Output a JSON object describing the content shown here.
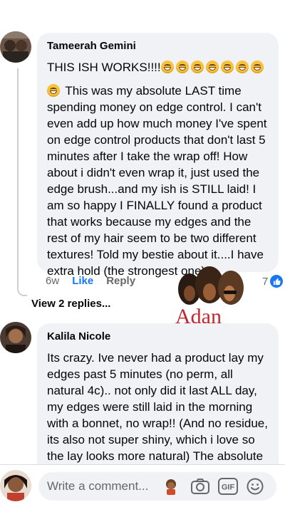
{
  "comments": [
    {
      "author": "Tameerah Gemini",
      "line1": "THIS ISH WORKS!!!!",
      "body": "This was my absolute LAST time spending money on edge control. I can't even add up how much money I've spent on edge control products that don't last 5 minutes after I take the wrap off! How about i didn't even wrap it, just used the edge brush...and my ish is STILL laid! I am so happy I FINALLY found a product that works because my edges and the rest of my hair seem to be two different textures! Told my bestie about it....I have extra hold (the strongest one)",
      "time": "6w",
      "like_label": "Like",
      "reply_label": "Reply",
      "reaction_count": "7",
      "view_replies": "View 2 replies..."
    },
    {
      "author": "Kalila Nicole",
      "body": "Its crazy. Ive never had a product lay my edges past 5 minutes (no perm, all natural 4c).. not only did it last ALL day, my edges were still laid in the morning with a bonnet, no wrap!! (And no residue, its also not super shiny, which i love so the lay looks more natural) The absolute truth. Im throwing out all the other edge controls"
    }
  ],
  "watermark": {
    "brand": "Adan"
  },
  "composer": {
    "placeholder": "Write a comment...",
    "icons": [
      "sticker-icon",
      "camera-icon",
      "gif-icon",
      "emoji-icon"
    ],
    "gif_label": "GIF"
  },
  "colors": {
    "accent": "#1877f2",
    "bubble": "#f0f2f5",
    "brand": "#c2272d"
  }
}
